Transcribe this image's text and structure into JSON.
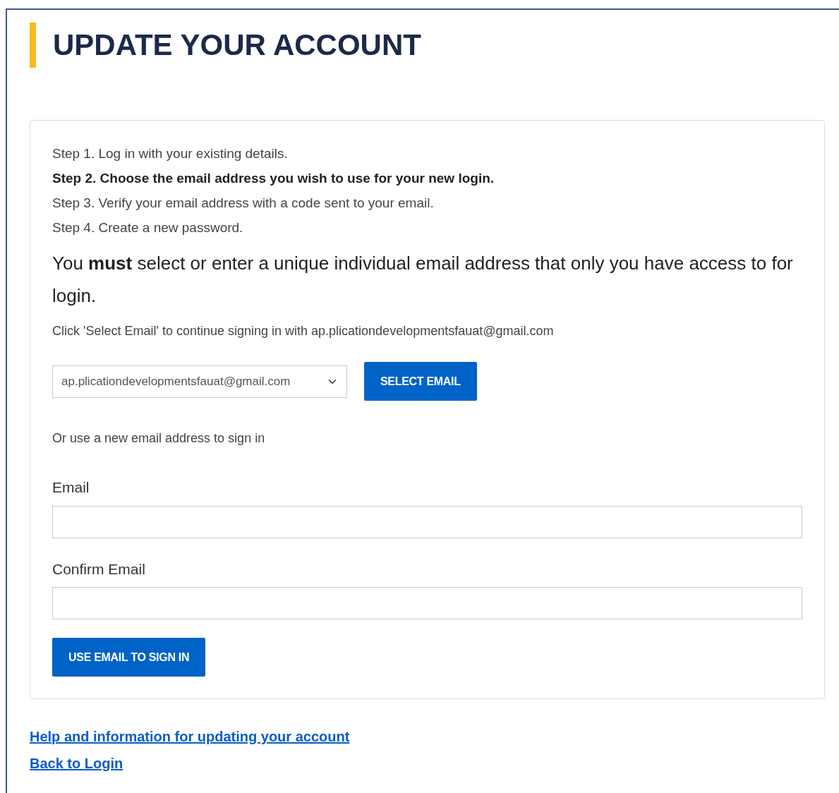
{
  "title": "UPDATE YOUR ACCOUNT",
  "steps": [
    {
      "text": "Step 1. Log in with your existing details.",
      "current": false
    },
    {
      "text": "Step 2. Choose the email address you wish to use for your new login.",
      "current": true
    },
    {
      "text": "Step 3. Verify your email address with a code sent to your email.",
      "current": false
    },
    {
      "text": "Step 4. Create a new password.",
      "current": false
    }
  ],
  "notice": "You **must** select or enter a unique individual email address that only you have access to for login.",
  "select_prompt": "Click 'Select Email' to continue signing in with ap.plicationdevelopmentsfauat@gmail.com",
  "email_select": {
    "value": "ap.plicationdevelopmentsfauat@gmail.com"
  },
  "select_button": "SELECT EMAIL",
  "alt_prompt": "Or use a new email address to sign in",
  "fields": [
    {
      "label": "Email"
    },
    {
      "label": "Confirm Email"
    }
  ],
  "submit_button": "USE EMAIL TO SIGN IN",
  "links": [
    "Help and information for updating your account",
    "Back to Login"
  ]
}
